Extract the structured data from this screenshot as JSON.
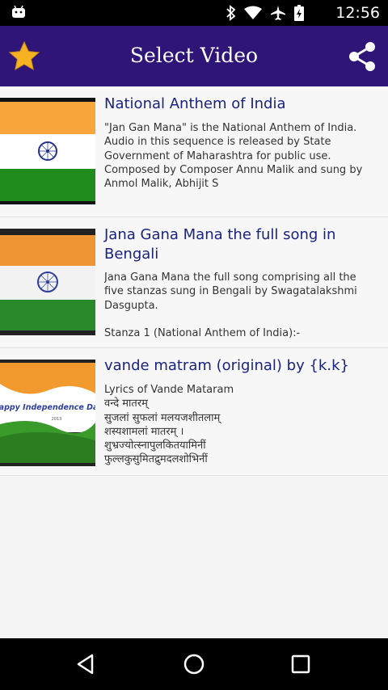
{
  "status_bar": {
    "time": "12:56",
    "icons": [
      "android-notification-icon",
      "bluetooth-icon",
      "wifi-icon",
      "airplane-mode-icon",
      "battery-icon"
    ]
  },
  "app_bar": {
    "title": "Select Video",
    "left_icon": "star-icon",
    "right_icon": "share-icon",
    "background_color": "#2e1577",
    "star_color": "#f5b324"
  },
  "videos": [
    {
      "title": "National Anthem of India",
      "description": "\"Jan Gan Mana\" is the National Anthem of India. Audio in this sequence is released by State Government of Maharashtra for public use. Composed by Composer Annu Malik and sung by Anmol Malik, Abhijit S",
      "thumbnail": "indian-flag"
    },
    {
      "title": "Jana Gana Mana the full song in Bengali",
      "description": "Jana Gana Mana the full song comprising all the five stanzas sung in Bengali by Swagatalakshmi Dasgupta.\n\nStanza 1 (National Anthem of India):-",
      "thumbnail": "indian-flag"
    },
    {
      "title": "vande matram  (original)  by {k.k}",
      "description": "Lyrics of Vande Mataram\nवन्दे मातरम्\nसुजलां सुफलां मलयजशीतलाम्\nशस्यशामलां मातरम् ।\nशुभ्रज्योत्स्नापुलकितयामिनीं\nफुल्लकुसुमितद्रुमदलशोभिनीं\nसुहासिनीं सुमधुर भाषिणीं",
      "thumbnail": "happy-independence-day-banner",
      "thumbnail_text": "Happy Independence Day"
    }
  ],
  "nav_bar": {
    "icons": [
      "back-icon",
      "home-icon",
      "recents-icon"
    ]
  }
}
